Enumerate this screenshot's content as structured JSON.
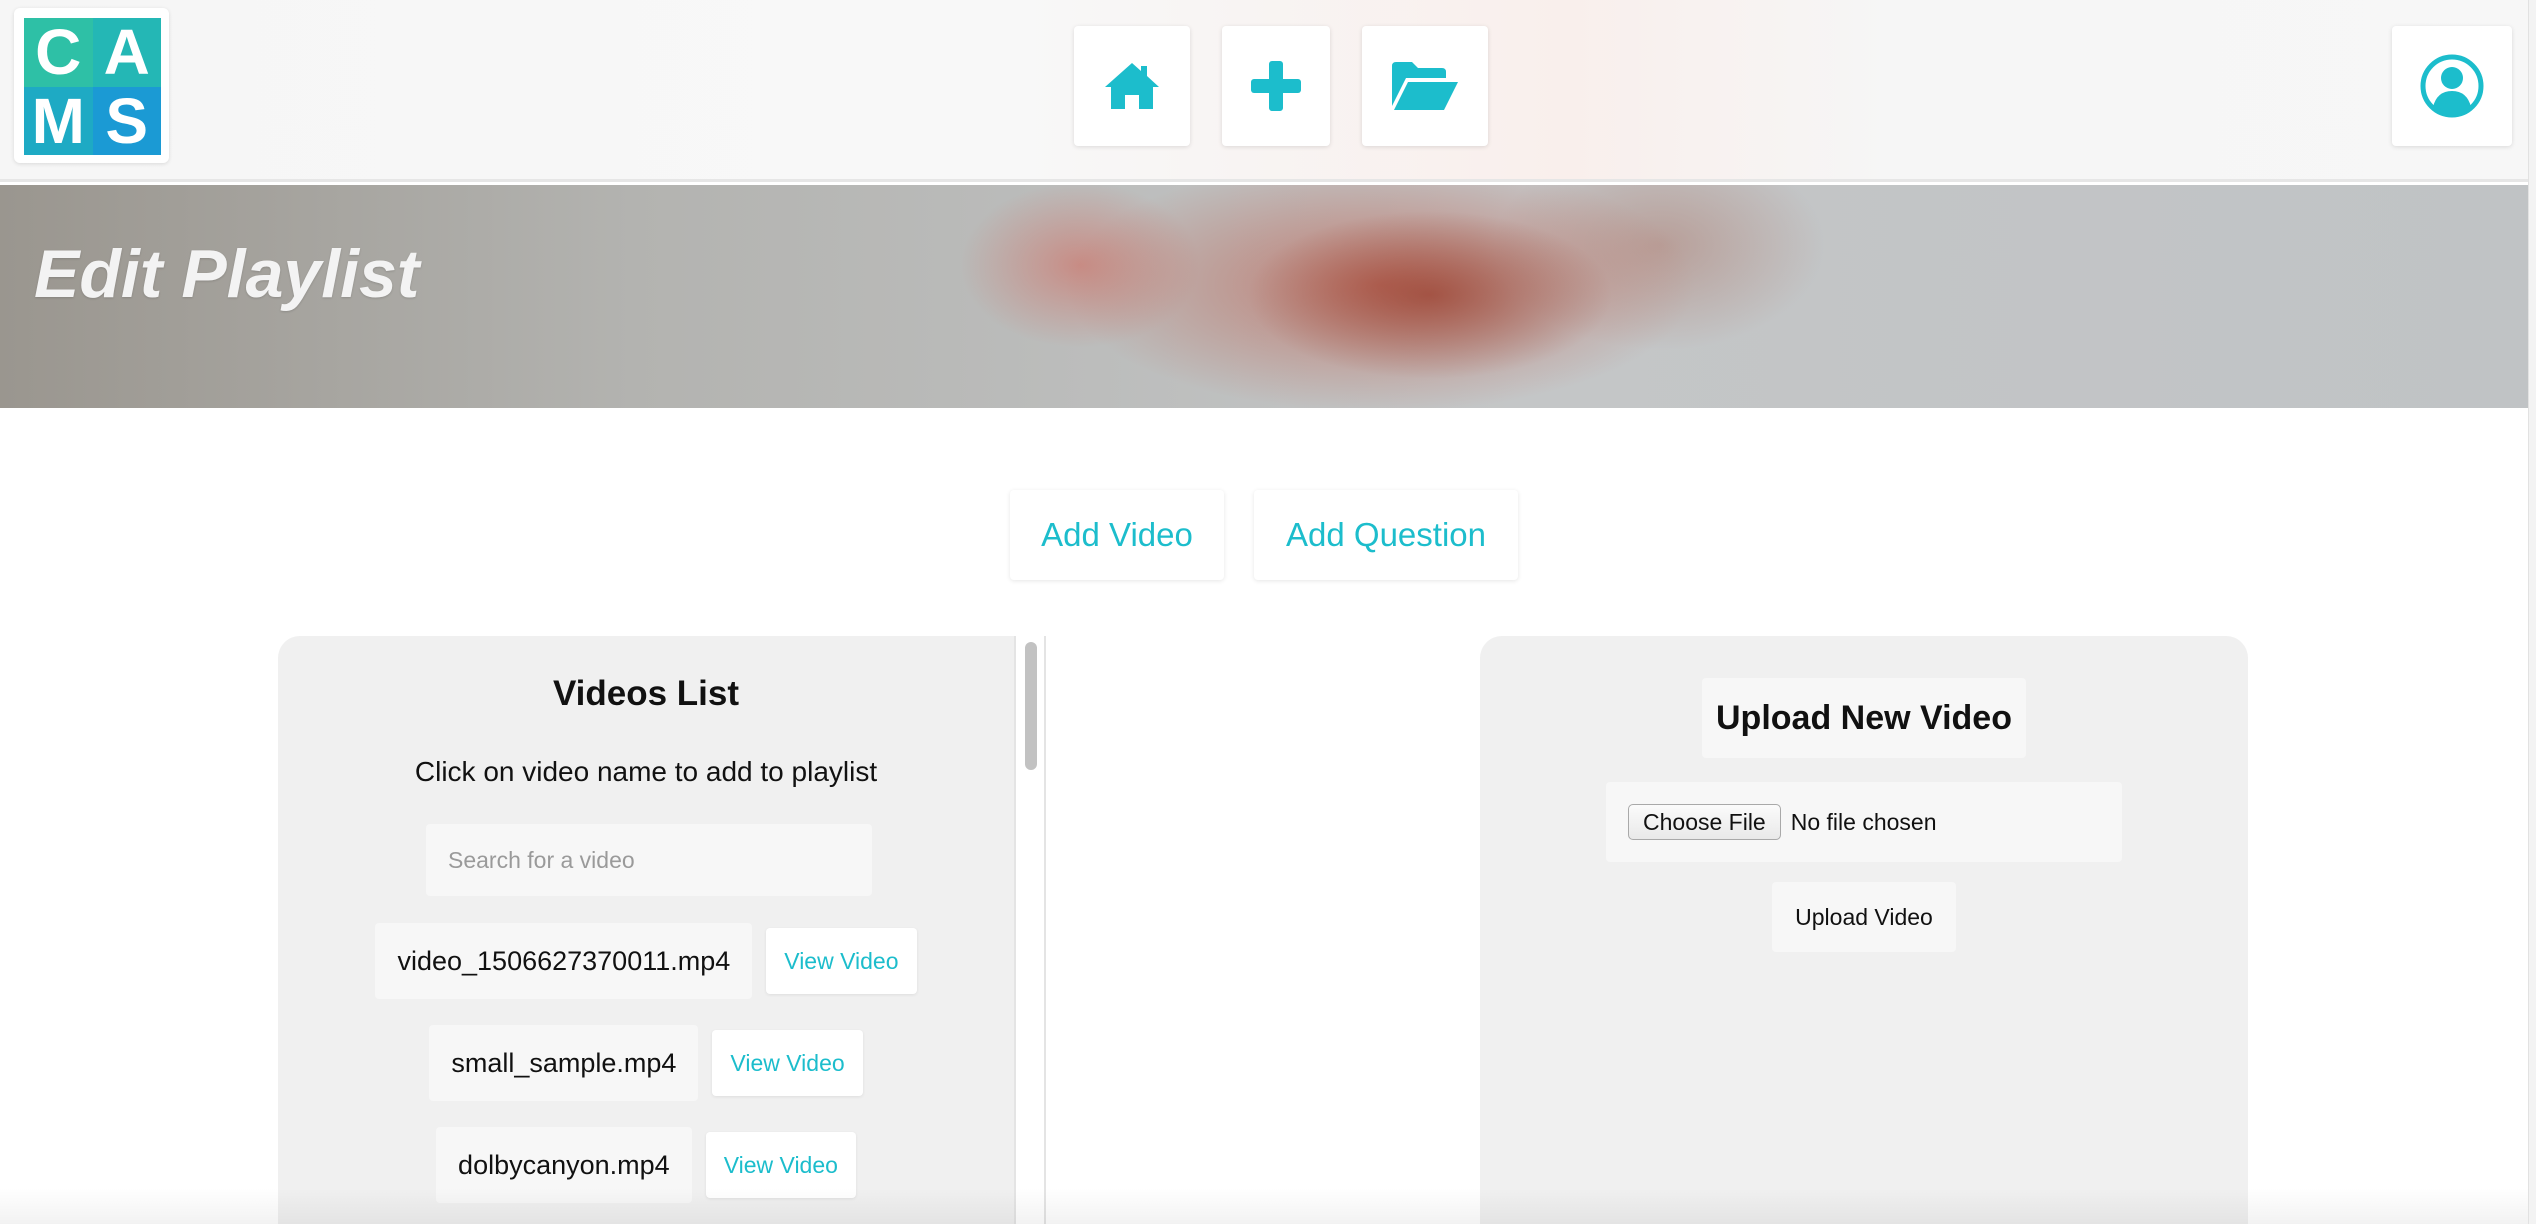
{
  "brand": {
    "logo_letters": [
      "C",
      "A",
      "M",
      "S"
    ],
    "accent_color": "#1cbdcc"
  },
  "nav": {
    "home_icon": "home-icon",
    "add_icon": "plus-icon",
    "folder_icon": "folder-open-icon",
    "account_icon": "user-circle-icon"
  },
  "banner": {
    "title": "Edit Playlist"
  },
  "actions": {
    "add_video": "Add Video",
    "add_question": "Add Question"
  },
  "videos_panel": {
    "title": "Videos List",
    "subtitle": "Click on video name to add to playlist",
    "search_placeholder": "Search for a video",
    "view_label": "View Video",
    "items": [
      {
        "name": "video_1506627370011.mp4"
      },
      {
        "name": "small_sample.mp4"
      },
      {
        "name": "dolbycanyon.mp4"
      }
    ]
  },
  "upload_panel": {
    "title": "Upload New Video",
    "choose_file": "Choose File",
    "file_status": "No file chosen",
    "upload_button": "Upload Video"
  }
}
